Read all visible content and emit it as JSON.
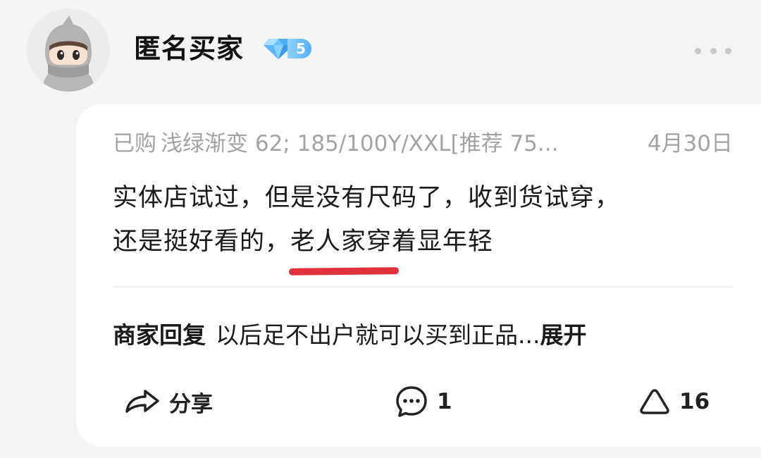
{
  "user": {
    "name": "匿名买家",
    "level": "5",
    "avatar_icon": "anonymous-ninja-avatar",
    "badge_icon": "diamond-icon"
  },
  "review": {
    "purchased_label": "已购",
    "spec": "浅绿渐变 62; 185/100Y/XXL[推荐 75...",
    "date": "4月30日",
    "text_line1": "实体店试过，但是没有尺码了，收到货试穿，",
    "text_line2_before": "还是挺好看的，",
    "text_line2_highlight": "老人家穿",
    "text_line2_after": "着显年轻",
    "highlight_color": "#e0313d"
  },
  "merchant_reply": {
    "label": "商家回复",
    "text": "以后足不出户就可以买到正品...",
    "expand_label": "展开"
  },
  "actions": {
    "share_label": "分享",
    "comment_count": "1",
    "like_count": "16",
    "share_icon": "share-arrow-icon",
    "comment_icon": "comment-bubble-icon",
    "like_icon": "triangle-like-icon"
  },
  "colors": {
    "background": "#f4f4f4",
    "card": "#ffffff",
    "muted_text": "#a3a3a3",
    "badge_blue": "#55aef5"
  }
}
